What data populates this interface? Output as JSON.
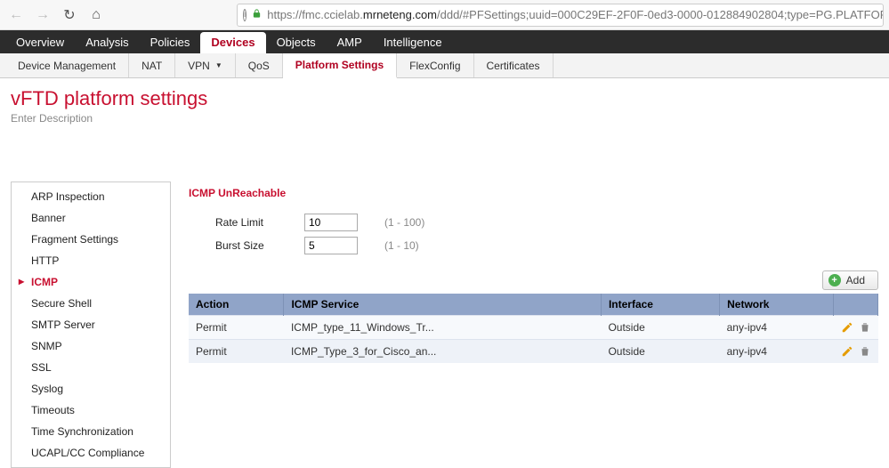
{
  "browser": {
    "url_scheme": "https://",
    "url_pre": "fmc.ccielab.",
    "url_domain": "mrneteng.com",
    "url_rest": "/ddd/#PFSettings;uuid=000C29EF-2F0F-0ed3-0000-012884902804;type=PG.PLATFORM.NgfwP"
  },
  "topnav": {
    "items": [
      {
        "label": "Overview"
      },
      {
        "label": "Analysis"
      },
      {
        "label": "Policies"
      },
      {
        "label": "Devices",
        "active": true
      },
      {
        "label": "Objects"
      },
      {
        "label": "AMP"
      },
      {
        "label": "Intelligence"
      }
    ]
  },
  "subnav": {
    "items": [
      {
        "label": "Device Management"
      },
      {
        "label": "NAT"
      },
      {
        "label": "VPN",
        "dropdown": true
      },
      {
        "label": "QoS"
      },
      {
        "label": "Platform Settings",
        "active": true
      },
      {
        "label": "FlexConfig"
      },
      {
        "label": "Certificates"
      }
    ]
  },
  "page": {
    "title": "vFTD platform settings",
    "description": "Enter Description"
  },
  "sidebar": {
    "items": [
      {
        "label": "ARP Inspection"
      },
      {
        "label": "Banner"
      },
      {
        "label": "Fragment Settings"
      },
      {
        "label": "HTTP"
      },
      {
        "label": "ICMP",
        "active": true
      },
      {
        "label": "Secure Shell"
      },
      {
        "label": "SMTP Server"
      },
      {
        "label": "SNMP"
      },
      {
        "label": "SSL"
      },
      {
        "label": "Syslog"
      },
      {
        "label": "Timeouts"
      },
      {
        "label": "Time Synchronization"
      },
      {
        "label": "UCAPL/CC Compliance"
      }
    ]
  },
  "panel": {
    "title": "ICMP UnReachable",
    "rate_limit_label": "Rate Limit",
    "rate_limit_value": "10",
    "rate_limit_hint": "(1 - 100)",
    "burst_size_label": "Burst Size",
    "burst_size_value": "5",
    "burst_size_hint": "(1 - 10)",
    "add_label": "Add"
  },
  "table": {
    "columns": {
      "action": "Action",
      "service": "ICMP Service",
      "interface": "Interface",
      "network": "Network"
    },
    "rows": [
      {
        "action": "Permit",
        "service": "ICMP_type_11_Windows_Tr...",
        "interface": "Outside",
        "network": "any-ipv4"
      },
      {
        "action": "Permit",
        "service": "ICMP_Type_3_for_Cisco_an...",
        "interface": "Outside",
        "network": "any-ipv4"
      }
    ]
  }
}
